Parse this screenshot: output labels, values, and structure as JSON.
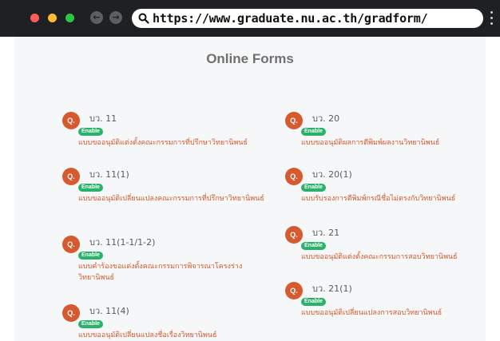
{
  "browser": {
    "url": "https://www.graduate.nu.ac.th/gradform/",
    "dots": [
      "#ff5f57",
      "#febc2e",
      "#28c840"
    ],
    "back_icon": "arrow-left-icon",
    "forward_icon": "arrow-right-icon"
  },
  "page": {
    "title": "Online Forms"
  },
  "status_label": "Enable",
  "icon_letter": "Q.",
  "colors": {
    "accent": "#d65a2e",
    "enable": "#29b36a"
  },
  "left_forms": [
    {
      "code": "บว. 11",
      "desc": "แบบขออนุมัติแต่งตั้งคณะกรรมการที่ปรึกษาวิทยานิพนธ์"
    },
    {
      "code": "บว. 11(1)",
      "desc": "แบบขออนุมัติเปลี่ยนแปลงคณะกรรมการที่ปรึกษาวิทยานิพนธ์"
    },
    {
      "code": "บว. 11(1-1/1-2)",
      "desc": "แบบคำร้องขอแต่งตั้งคณะกรรมการพิจารณาโครงร่างวิทยานิพนธ์"
    },
    {
      "code": "บว. 11(4)",
      "desc": "แบบขออนุมัติเปลี่ยนแปลงชื่อเรื่องวิทยานิพนธ์"
    }
  ],
  "right_forms": [
    {
      "code": "บว. 20",
      "desc": "แบบขออนุมัติผลการตีพิมพ์ผลงานวิทยานิพนธ์"
    },
    {
      "code": "บว. 20(1)",
      "desc": "แบบรับรองการตีพิมพ์กรณีชื่อไม่ตรงกับวิทยานิพนธ์"
    },
    {
      "code": "บว. 21",
      "desc": "แบบขออนุมัติแต่งตั้งคณะกรรมการสอบวิทยานิพนธ์"
    },
    {
      "code": "บว. 21(1)",
      "desc": "แบบขออนุมัติเปลี่ยนแปลงการสอบวิทยานิพนธ์"
    }
  ]
}
